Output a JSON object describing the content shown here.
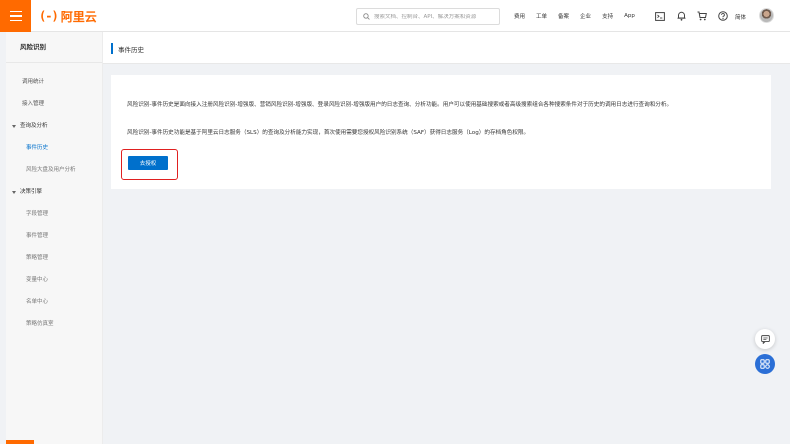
{
  "header": {
    "logo_mark": "(-)",
    "logo_text": "阿里云",
    "search_placeholder": "搜索文档、控制台、API、解决方案和资源",
    "nav_links": [
      "费用",
      "工单",
      "备案",
      "企业",
      "支持",
      "App"
    ],
    "user_label": "简体"
  },
  "sidebar": {
    "title": "风险识别",
    "items": [
      {
        "label": "调用统计"
      },
      {
        "label": "接入管理"
      },
      {
        "label": "查询及分析"
      },
      {
        "label": "事件历史"
      },
      {
        "label": "风险大盘及用户分析"
      },
      {
        "label": "决策引擎"
      },
      {
        "label": "字段管理"
      },
      {
        "label": "事件管理"
      },
      {
        "label": "策略管理"
      },
      {
        "label": "变量中心"
      },
      {
        "label": "名单中心"
      },
      {
        "label": "策略仿真室"
      }
    ]
  },
  "page": {
    "title": "事件历史",
    "paragraph1": "风险识别-事件历史是面向接入注册风险识别-增强版、营销风险识别-增强版、登录风险识别-增强版用户的日志查询、分析功能。用户可以使用基础搜索或者高级搜索组合各种搜索条件对于历史的调用日志进行查询和分析。",
    "paragraph2": "风险识别-事件历史功能是基于阿里云日志服务（SLS）的查询及分析能力实现，首次使用需要您授权风险识别系统（SAF）获得日志服务（Log）的存档角色权限。",
    "auth_button": "去授权"
  },
  "colors": {
    "brand": "#ff6a00",
    "primary": "#0070cc",
    "highlight": "#e02020"
  },
  "icons": {
    "search": "search-icon",
    "chat": "chat-icon",
    "apps": "apps-icon"
  }
}
